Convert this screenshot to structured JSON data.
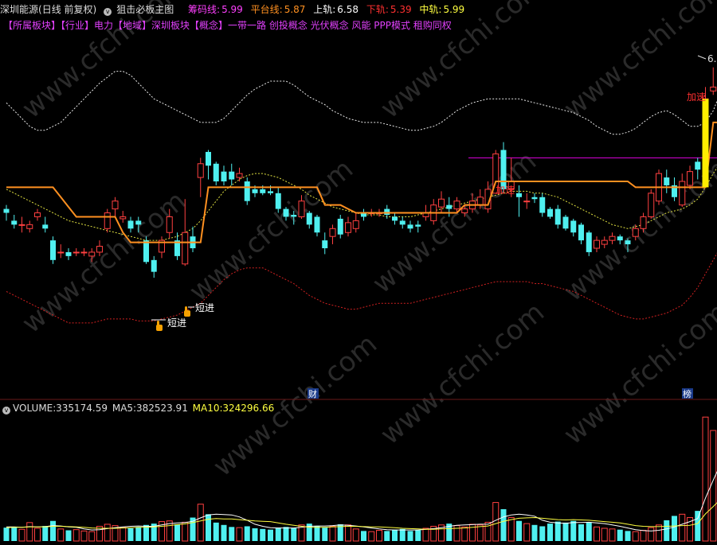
{
  "header": {
    "stock_name": "深圳能源",
    "period": "(日线 前复权)",
    "indicator_name": "狙击必板主图",
    "chips_label": "筹码线:",
    "chips_value": "5.99",
    "flat_label": "平台线:",
    "flat_value": "5.87",
    "upper_label": "上轨:",
    "upper_value": "6.58",
    "lower_label": "下轨:",
    "lower_value": "5.39",
    "mid_label": "中轨:",
    "mid_value": "5.99"
  },
  "concepts": "【所属板块】【行业】电力【地域】深圳板块【概念】一带一路 创投概念 光伏概念 风能 PPP模式 租购同权",
  "volume_header": {
    "volume_label": "VOLUME:",
    "volume_value": "335174.59",
    "ma5_label": "MA5:",
    "ma5_value": "382523.91",
    "ma10_label": "MA10:",
    "ma10_value": "324296.66"
  },
  "annotations": {
    "short_in_1": "短进",
    "short_in_2": "短进",
    "accelerate_1": "加速",
    "accelerate_2": "加速",
    "price_tag": "6.",
    "marker_cai": "财",
    "marker_bang": "榜"
  },
  "watermark": "www.cfchi.com",
  "colors": {
    "up": "#ff4040",
    "down": "#4ff0f0",
    "platform": "#ff9020",
    "ma5": "#ffffff",
    "ma10": "#ffff40",
    "magenta_line": "#e000e0"
  },
  "chart_data": [
    {
      "type": "candlestick",
      "ylim": [
        5.0,
        6.7
      ],
      "candles": [
        [
          5.88,
          5.86,
          5.9,
          5.82
        ],
        [
          5.82,
          5.8,
          5.85,
          5.78
        ],
        [
          5.8,
          5.8,
          5.84,
          5.76
        ],
        [
          5.78,
          5.8,
          5.82,
          5.76
        ],
        [
          5.84,
          5.86,
          5.88,
          5.82
        ],
        [
          5.8,
          5.78,
          5.84,
          5.76
        ],
        [
          5.72,
          5.62,
          5.74,
          5.6
        ],
        [
          5.66,
          5.66,
          5.7,
          5.63
        ],
        [
          5.66,
          5.64,
          5.68,
          5.62
        ],
        [
          5.66,
          5.66,
          5.68,
          5.64
        ],
        [
          5.66,
          5.66,
          5.68,
          5.64
        ],
        [
          5.64,
          5.66,
          5.68,
          5.61
        ],
        [
          5.66,
          5.69,
          5.72,
          5.64
        ],
        [
          5.78,
          5.86,
          5.88,
          5.76
        ],
        [
          5.88,
          5.92,
          5.94,
          5.84
        ],
        [
          5.83,
          5.84,
          5.87,
          5.81
        ],
        [
          5.82,
          5.78,
          5.84,
          5.76
        ],
        [
          5.82,
          5.8,
          5.84,
          5.76
        ],
        [
          5.72,
          5.61,
          5.74,
          5.6
        ],
        [
          5.62,
          5.56,
          5.64,
          5.53
        ],
        [
          5.66,
          5.72,
          5.74,
          5.63
        ],
        [
          5.76,
          5.84,
          5.88,
          5.73
        ],
        [
          5.72,
          5.64,
          5.76,
          5.62
        ],
        [
          5.6,
          5.76,
          5.93,
          5.59
        ],
        [
          5.74,
          5.68,
          5.79,
          5.66
        ],
        [
          6.04,
          6.11,
          6.14,
          5.94
        ],
        [
          6.17,
          6.1,
          6.18,
          6.03
        ],
        [
          6.11,
          6.02,
          6.12,
          6.0
        ],
        [
          6.07,
          6.02,
          6.1,
          6.0
        ],
        [
          6.07,
          6.03,
          6.11,
          6.0
        ],
        [
          6.04,
          6.06,
          6.09,
          6.02
        ],
        [
          6.02,
          5.92,
          6.04,
          5.9
        ],
        [
          5.98,
          5.96,
          6.0,
          5.94
        ],
        [
          5.98,
          5.96,
          6.0,
          5.95
        ],
        [
          5.97,
          5.96,
          6.0,
          5.95
        ],
        [
          5.96,
          5.88,
          5.99,
          5.86
        ],
        [
          5.88,
          5.84,
          5.89,
          5.82
        ],
        [
          5.85,
          5.84,
          5.87,
          5.8
        ],
        [
          5.84,
          5.92,
          5.95,
          5.83
        ],
        [
          5.86,
          5.8,
          5.87,
          5.78
        ],
        [
          5.84,
          5.76,
          5.85,
          5.74
        ],
        [
          5.72,
          5.68,
          5.76,
          5.65
        ],
        [
          5.74,
          5.78,
          5.8,
          5.7
        ],
        [
          5.83,
          5.75,
          5.85,
          5.73
        ],
        [
          5.76,
          5.81,
          5.84,
          5.74
        ],
        [
          5.78,
          5.82,
          5.86,
          5.76
        ],
        [
          5.86,
          5.84,
          5.88,
          5.82
        ],
        [
          5.86,
          5.86,
          5.88,
          5.84
        ],
        [
          5.86,
          5.86,
          5.88,
          5.84
        ],
        [
          5.88,
          5.85,
          5.9,
          5.83
        ],
        [
          5.84,
          5.82,
          5.86,
          5.8
        ],
        [
          5.82,
          5.8,
          5.84,
          5.78
        ],
        [
          5.8,
          5.78,
          5.82,
          5.76
        ],
        [
          5.8,
          5.79,
          5.82,
          5.76
        ],
        [
          5.84,
          5.86,
          5.9,
          5.82
        ],
        [
          5.82,
          5.9,
          5.93,
          5.8
        ],
        [
          5.89,
          5.93,
          5.97,
          5.86
        ],
        [
          5.9,
          5.88,
          5.94,
          5.84
        ],
        [
          5.88,
          5.92,
          5.94,
          5.86
        ],
        [
          5.86,
          5.88,
          5.9,
          5.84
        ],
        [
          5.88,
          5.92,
          5.96,
          5.86
        ],
        [
          5.9,
          5.94,
          5.98,
          5.88
        ],
        [
          5.88,
          5.98,
          6.02,
          5.86
        ],
        [
          5.96,
          6.16,
          6.18,
          5.96
        ],
        [
          6.18,
          5.98,
          6.22,
          5.96
        ],
        [
          5.98,
          6.02,
          6.14,
          5.94
        ],
        [
          5.96,
          5.94,
          6.0,
          5.84
        ],
        [
          5.92,
          5.92,
          5.96,
          5.88
        ],
        [
          5.94,
          5.93,
          5.96,
          5.91
        ],
        [
          5.94,
          5.86,
          5.96,
          5.84
        ],
        [
          5.88,
          5.84,
          5.89,
          5.83
        ],
        [
          5.88,
          5.8,
          5.9,
          5.78
        ],
        [
          5.84,
          5.78,
          5.85,
          5.77
        ],
        [
          5.82,
          5.76,
          5.83,
          5.74
        ],
        [
          5.8,
          5.72,
          5.81,
          5.7
        ],
        [
          5.76,
          5.66,
          5.77,
          5.64
        ],
        [
          5.68,
          5.72,
          5.74,
          5.66
        ],
        [
          5.7,
          5.72,
          5.74,
          5.68
        ],
        [
          5.72,
          5.74,
          5.76,
          5.7
        ],
        [
          5.74,
          5.72,
          5.75,
          5.7
        ],
        [
          5.72,
          5.7,
          5.73,
          5.66
        ],
        [
          5.74,
          5.78,
          5.8,
          5.72
        ],
        [
          5.78,
          5.84,
          5.86,
          5.76
        ],
        [
          5.84,
          5.96,
          5.98,
          5.83
        ],
        [
          5.92,
          6.06,
          6.08,
          5.9
        ],
        [
          6.04,
          6.0,
          6.08,
          5.96
        ],
        [
          6.0,
          5.94,
          6.04,
          5.92
        ],
        [
          5.9,
          6.02,
          6.06,
          5.89
        ],
        [
          6.0,
          6.07,
          6.1,
          5.98
        ],
        [
          6.12,
          6.08,
          6.14,
          6.03
        ],
        [
          6.08,
          6.44,
          6.5,
          6.06
        ],
        [
          6.48,
          6.5,
          6.6,
          6.46
        ],
        [
          6.46,
          6.28,
          6.5,
          6.24
        ]
      ],
      "lines": {
        "platform": [
          5.99,
          5.99,
          5.99,
          5.99,
          5.99,
          5.99,
          5.99,
          5.94,
          5.89,
          5.84,
          5.84,
          5.84,
          5.84,
          5.84,
          5.84,
          5.76,
          5.71,
          5.71,
          5.71,
          5.71,
          5.71,
          5.71,
          5.71,
          5.71,
          5.71,
          5.71,
          5.99,
          5.99,
          5.99,
          5.99,
          5.99,
          5.99,
          5.99,
          5.99,
          5.99,
          5.99,
          5.99,
          5.99,
          5.99,
          5.99,
          5.99,
          5.9,
          5.9,
          5.9,
          5.88,
          5.86,
          5.86,
          5.86,
          5.86,
          5.86,
          5.86,
          5.86,
          5.86,
          5.86,
          5.86,
          5.86,
          5.86,
          5.86,
          5.86,
          5.9,
          5.9,
          5.9,
          5.9,
          6.02,
          6.02,
          6.02,
          6.02,
          6.02,
          6.02,
          6.02,
          6.02,
          6.02,
          6.02,
          6.02,
          6.02,
          6.02,
          6.02,
          6.02,
          6.02,
          6.02,
          6.02,
          5.99,
          5.99,
          5.99,
          5.99,
          5.99,
          5.99,
          5.99,
          5.99,
          5.99,
          5.99,
          6.32,
          6.32,
          6.32
        ],
        "upper_band": [
          6.42,
          6.38,
          6.34,
          6.3,
          6.28,
          6.28,
          6.3,
          6.32,
          6.36,
          6.4,
          6.44,
          6.48,
          6.52,
          6.55,
          6.58,
          6.58,
          6.56,
          6.52,
          6.48,
          6.44,
          6.42,
          6.4,
          6.38,
          6.36,
          6.34,
          6.32,
          6.32,
          6.32,
          6.34,
          6.38,
          6.42,
          6.46,
          6.49,
          6.51,
          6.53,
          6.53,
          6.53,
          6.51,
          6.48,
          6.45,
          6.43,
          6.41,
          6.38,
          6.36,
          6.34,
          6.33,
          6.32,
          6.32,
          6.32,
          6.31,
          6.3,
          6.29,
          6.28,
          6.28,
          6.29,
          6.3,
          6.32,
          6.35,
          6.38,
          6.4,
          6.42,
          6.43,
          6.44,
          6.44,
          6.44,
          6.44,
          6.44,
          6.43,
          6.42,
          6.41,
          6.4,
          6.39,
          6.38,
          6.37,
          6.35,
          6.33,
          6.3,
          6.28,
          6.26,
          6.26,
          6.27,
          6.29,
          6.32,
          6.35,
          6.37,
          6.38,
          6.36,
          6.33,
          6.3,
          6.3,
          6.32,
          6.38,
          6.48,
          6.56
        ],
        "mid_band": [
          5.98,
          5.96,
          5.94,
          5.92,
          5.9,
          5.88,
          5.86,
          5.84,
          5.82,
          5.81,
          5.8,
          5.79,
          5.78,
          5.77,
          5.76,
          5.75,
          5.74,
          5.73,
          5.72,
          5.72,
          5.72,
          5.73,
          5.74,
          5.76,
          5.78,
          5.82,
          5.87,
          5.92,
          5.97,
          6.0,
          6.03,
          6.05,
          6.06,
          6.06,
          6.05,
          6.04,
          6.02,
          6.0,
          5.98,
          5.95,
          5.93,
          5.91,
          5.89,
          5.88,
          5.87,
          5.86,
          5.85,
          5.85,
          5.85,
          5.84,
          5.84,
          5.84,
          5.84,
          5.85,
          5.86,
          5.87,
          5.88,
          5.89,
          5.9,
          5.91,
          5.92,
          5.93,
          5.94,
          5.95,
          5.96,
          5.97,
          5.97,
          5.97,
          5.96,
          5.96,
          5.95,
          5.94,
          5.92,
          5.9,
          5.88,
          5.86,
          5.84,
          5.82,
          5.8,
          5.79,
          5.78,
          5.79,
          5.8,
          5.82,
          5.84,
          5.86,
          5.87,
          5.88,
          5.9,
          5.93,
          5.99,
          6.06,
          6.12,
          6.15
        ],
        "lower_band": [
          5.46,
          5.44,
          5.42,
          5.4,
          5.38,
          5.36,
          5.34,
          5.32,
          5.3,
          5.3,
          5.3,
          5.3,
          5.31,
          5.32,
          5.32,
          5.32,
          5.32,
          5.31,
          5.31,
          5.31,
          5.32,
          5.33,
          5.34,
          5.36,
          5.38,
          5.4,
          5.44,
          5.48,
          5.52,
          5.55,
          5.57,
          5.58,
          5.58,
          5.58,
          5.56,
          5.54,
          5.52,
          5.5,
          5.47,
          5.44,
          5.42,
          5.4,
          5.39,
          5.38,
          5.37,
          5.37,
          5.38,
          5.39,
          5.4,
          5.4,
          5.4,
          5.4,
          5.4,
          5.41,
          5.42,
          5.43,
          5.44,
          5.45,
          5.46,
          5.47,
          5.48,
          5.49,
          5.5,
          5.51,
          5.51,
          5.51,
          5.51,
          5.51,
          5.5,
          5.5,
          5.49,
          5.48,
          5.47,
          5.46,
          5.44,
          5.42,
          5.4,
          5.38,
          5.36,
          5.34,
          5.33,
          5.32,
          5.32,
          5.33,
          5.34,
          5.35,
          5.37,
          5.39,
          5.43,
          5.48,
          5.55,
          5.62,
          5.69,
          5.75
        ]
      },
      "magenta_level": 6.14
    },
    {
      "type": "bar",
      "series": [
        {
          "name": "VOLUME",
          "values": [
            40,
            42,
            35,
            55,
            38,
            45,
            60,
            36,
            32,
            34,
            30,
            28,
            44,
            50,
            46,
            40,
            38,
            42,
            48,
            52,
            58,
            60,
            50,
            56,
            70,
            110,
            80,
            55,
            48,
            42,
            40,
            44,
            38,
            36,
            34,
            40,
            42,
            38,
            48,
            52,
            45,
            40,
            44,
            50,
            48,
            36,
            30,
            28,
            32,
            30,
            34,
            36,
            30,
            32,
            38,
            44,
            48,
            52,
            46,
            42,
            50,
            48,
            56,
            115,
            95,
            70,
            60,
            52,
            48,
            44,
            52,
            58,
            55,
            60,
            50,
            56,
            42,
            38,
            36,
            34,
            30,
            28,
            32,
            40,
            48,
            62,
            75,
            80,
            70,
            90,
            370,
            330,
            300,
            335
          ]
        }
      ],
      "lines": {
        "MA5": [
          42,
          42,
          41,
          43,
          42,
          43,
          46,
          45,
          42,
          41,
          36,
          33,
          34,
          37,
          40,
          42,
          44,
          45,
          44,
          44,
          48,
          52,
          54,
          55,
          59,
          69,
          78,
          80,
          79,
          78,
          72,
          62,
          50,
          44,
          40,
          39,
          39,
          39,
          41,
          44,
          45,
          45,
          46,
          48,
          47,
          45,
          42,
          39,
          36,
          34,
          33,
          33,
          33,
          33,
          35,
          37,
          40,
          44,
          47,
          48,
          49,
          50,
          50,
          62,
          72,
          78,
          80,
          78,
          74,
          62,
          56,
          54,
          53,
          55,
          55,
          56,
          54,
          52,
          48,
          44,
          39,
          34,
          31,
          30,
          32,
          36,
          42,
          50,
          58,
          67,
          128,
          182,
          232,
          275
        ],
        "MA10": [
          40,
          41,
          41,
          42,
          42,
          42,
          44,
          44,
          43,
          42,
          41,
          39,
          38,
          38,
          38,
          39,
          40,
          41,
          41,
          42,
          44,
          46,
          49,
          51,
          55,
          60,
          65,
          67,
          66,
          66,
          64,
          62,
          60,
          59,
          58,
          54,
          50,
          47,
          44,
          41,
          41,
          41,
          42,
          43,
          44,
          44,
          43,
          42,
          42,
          41,
          40,
          38,
          37,
          36,
          35,
          35,
          36,
          37,
          38,
          39,
          41,
          43,
          45,
          52,
          59,
          64,
          68,
          69,
          70,
          68,
          66,
          64,
          63,
          64,
          63,
          62,
          60,
          58,
          56,
          54,
          50,
          46,
          44,
          43,
          43,
          44,
          45,
          46,
          47,
          52,
          81,
          103,
          126,
          152
        ]
      }
    }
  ]
}
